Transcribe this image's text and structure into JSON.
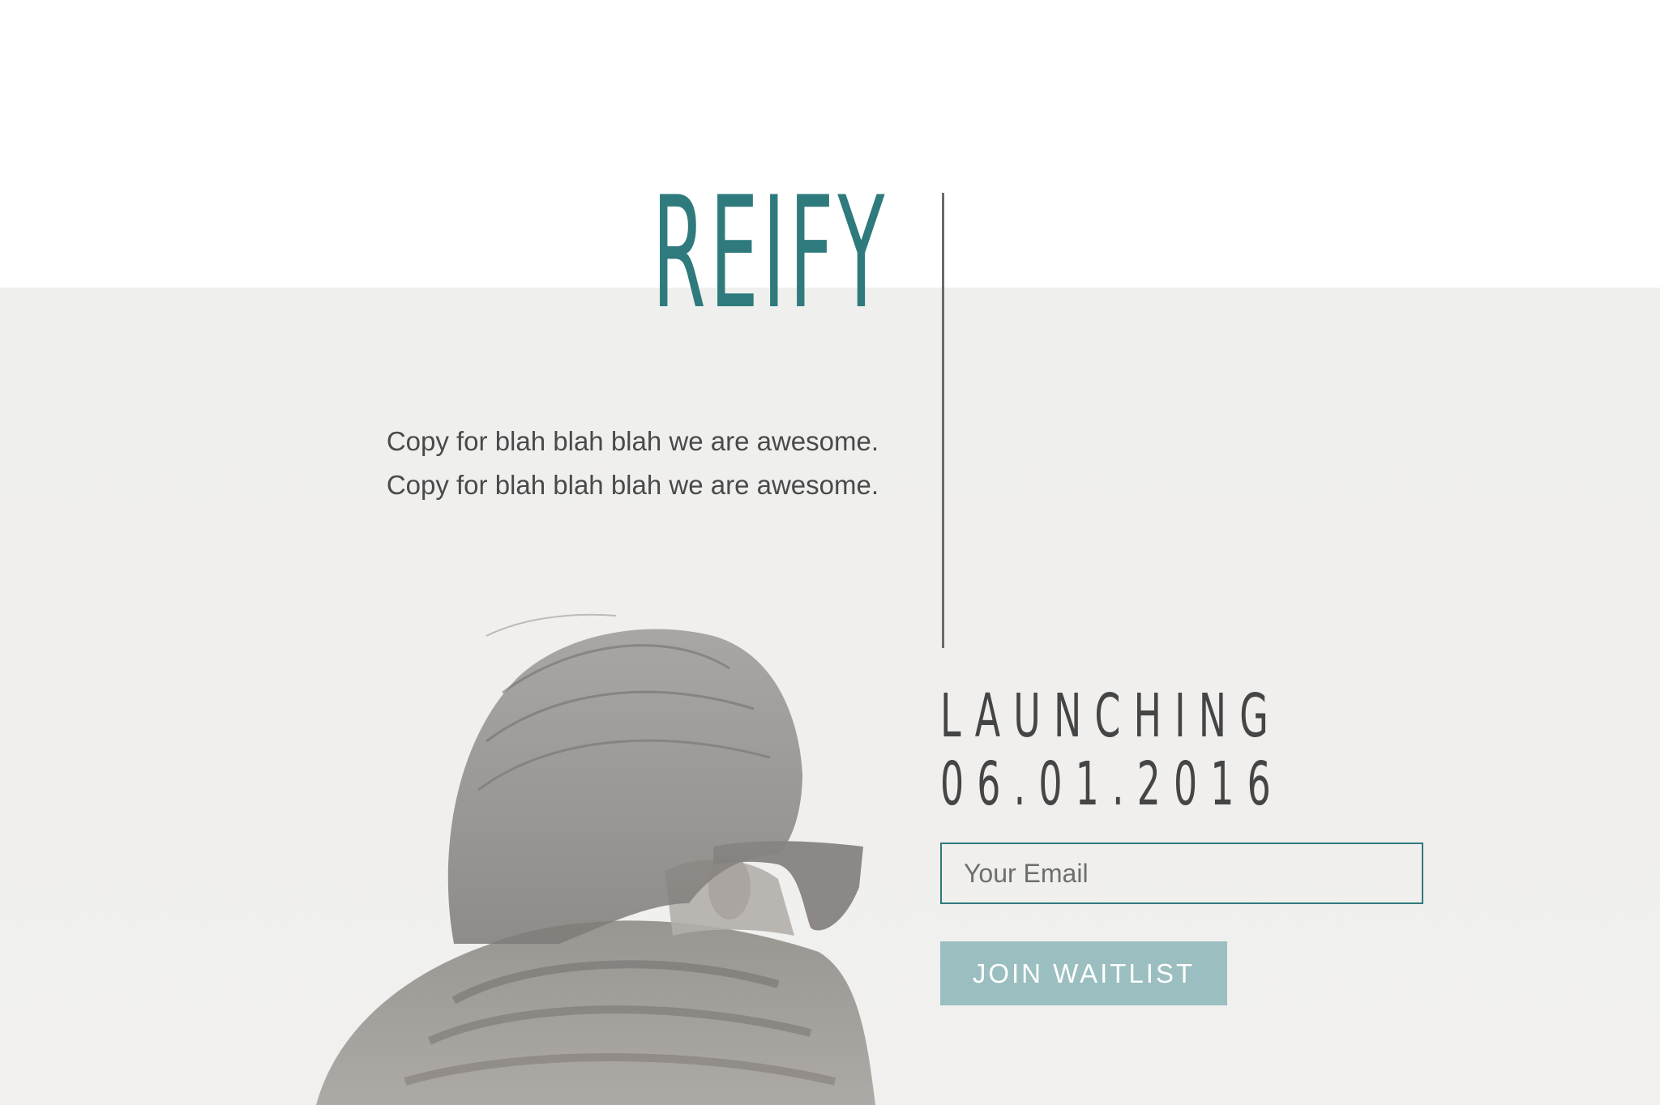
{
  "brand": {
    "name": "REIFY",
    "color": "#2f7a7d"
  },
  "tagline": {
    "lines": [
      "Copy for blah blah blah we are awesome.",
      "Copy for blah blah blah we are awesome."
    ]
  },
  "launch": {
    "label": "LAUNCHING",
    "date": "06.01.2016"
  },
  "waitlist": {
    "email_placeholder": "Your Email",
    "email_value": "",
    "join_label": "JOIN WAITLIST",
    "button_color": "#9bbec0"
  },
  "hero_image": {
    "subject": "person-with-sunglasses-and-scarf-photo"
  }
}
